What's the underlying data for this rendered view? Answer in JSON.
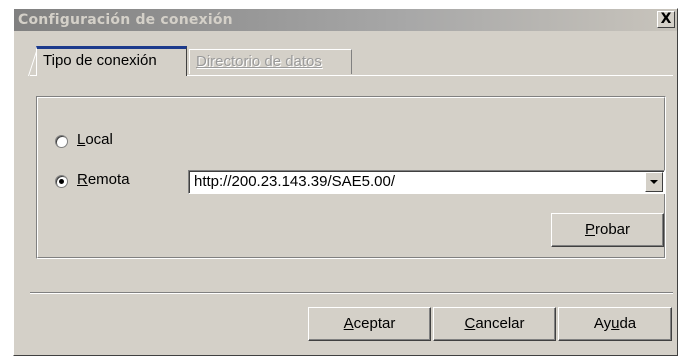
{
  "window": {
    "title": "Configuración de conexión",
    "close_label": "X"
  },
  "tabs": [
    {
      "label": "Tipo de conexión",
      "active": true
    },
    {
      "label": "Directorio de datos",
      "active": false
    }
  ],
  "connection": {
    "local": {
      "prefix": "",
      "accel": "L",
      "rest": "ocal",
      "selected": false
    },
    "remote": {
      "prefix": "",
      "accel": "R",
      "rest": "emota",
      "selected": true
    },
    "url_value": "http://200.23.143.39/SAE5.00/",
    "test_button": {
      "accel": "P",
      "rest": "robar"
    }
  },
  "buttons": {
    "accept": {
      "accel": "A",
      "rest": "ceptar"
    },
    "cancel": {
      "accel": "C",
      "rest": "ancelar"
    },
    "help": {
      "prefix": "Ay",
      "accel": "u",
      "rest": "da"
    }
  },
  "colors": {
    "face": "#d4d0c8",
    "active_tab_accent": "#1c3a8c",
    "title_text": "#d4d0c8"
  }
}
